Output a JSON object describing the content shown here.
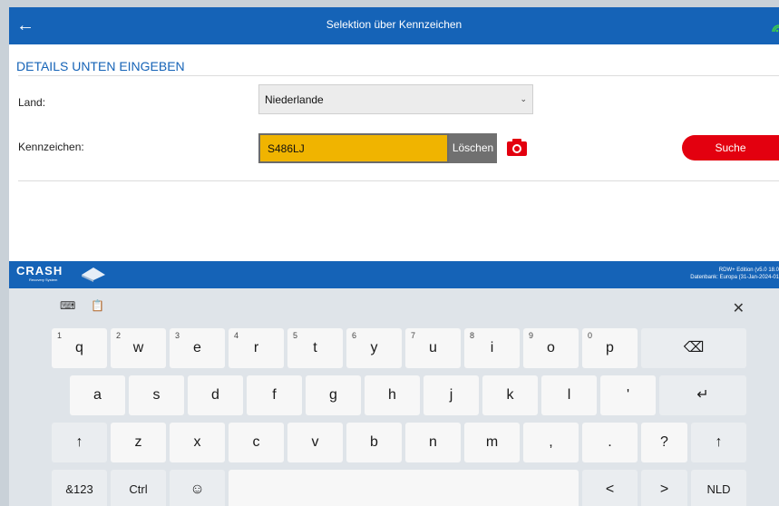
{
  "header": {
    "back_icon": "arrow-left-icon",
    "title": "Selektion über Kennzeichen",
    "accent": "#1563b7"
  },
  "details": {
    "section_title": "DETAILS UNTEN EINGEBEN",
    "country_label": "Land:",
    "country_value": "Niederlande",
    "plate_label": "Kennzeichen:",
    "plate_value": "S486LJ",
    "clear_label": "Löschen",
    "search_label": "Suche",
    "plate_color": "#f0b400",
    "search_color": "#e3000f"
  },
  "footer": {
    "logo": "CRASH",
    "logo_sub": "Recovery System",
    "version_line1": "RDW+ Edition (v5.0 18.0",
    "version_line2": "Datenbank: Europa (31-Jan-2024-01"
  },
  "keyboard": {
    "toolbar": {
      "layout_icon": "keyboard-settings-icon",
      "clipboard_icon": "clipboard-icon",
      "close_icon": "close-icon"
    },
    "row1": [
      {
        "label": "q",
        "hint": "1"
      },
      {
        "label": "w",
        "hint": "2"
      },
      {
        "label": "e",
        "hint": "3"
      },
      {
        "label": "r",
        "hint": "4"
      },
      {
        "label": "t",
        "hint": "5"
      },
      {
        "label": "y",
        "hint": "6"
      },
      {
        "label": "u",
        "hint": "7"
      },
      {
        "label": "i",
        "hint": "8"
      },
      {
        "label": "o",
        "hint": "9"
      },
      {
        "label": "p",
        "hint": "0"
      }
    ],
    "backspace": "⌫",
    "row2": [
      "a",
      "s",
      "d",
      "f",
      "g",
      "h",
      "j",
      "k",
      "l",
      "'"
    ],
    "enter": "↵",
    "shift": "↑",
    "row3": [
      "z",
      "x",
      "c",
      "v",
      "b",
      "n",
      "m",
      ",",
      ".",
      "?"
    ],
    "symbols": "&123",
    "ctrl": "Ctrl",
    "emoji": "☺",
    "left": "<",
    "right": ">",
    "language": "NLD"
  }
}
